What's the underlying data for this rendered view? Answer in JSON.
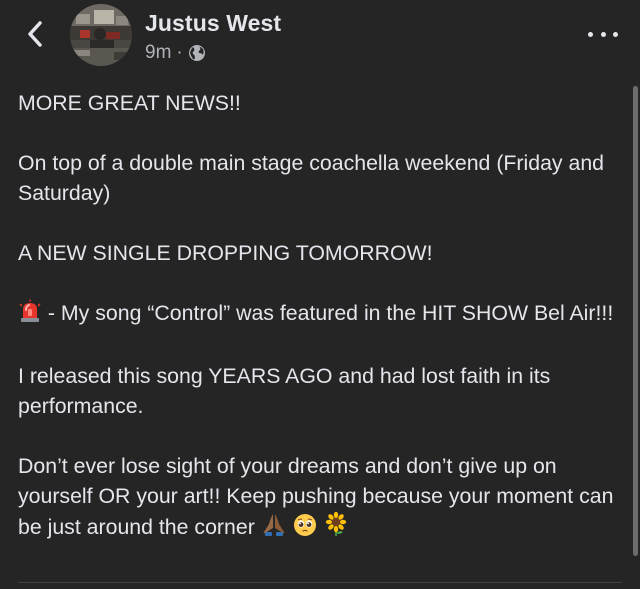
{
  "header": {
    "author_name": "Justus West",
    "timestamp": "9m",
    "separator": "·",
    "audience_icon": "globe-icon",
    "back_icon": "chevron-left-icon",
    "more_icon": "more-dots-icon"
  },
  "post": {
    "paragraphs": [
      "MORE GREAT NEWS!!",
      "On top of a double main stage coachella weekend (Friday and Saturday)",
      "A NEW SINGLE DROPPING TOMORROW!",
      " - My song “Control” was featured in the HIT SHOW Bel Air!!!",
      "I released this song YEARS AGO and had lost faith in its performance.",
      "Don’t ever lose sight of your dreams and don’t give up on yourself OR your art!! Keep pushing because your moment can be just around the corner "
    ],
    "emojis": [
      "siren-emoji",
      "folded-hands-emoji",
      "pleading-face-emoji",
      "sunflower-emoji"
    ]
  },
  "colors": {
    "background": "#252526",
    "text": "#e4e6eb",
    "secondary_text": "#b0b3b8"
  }
}
